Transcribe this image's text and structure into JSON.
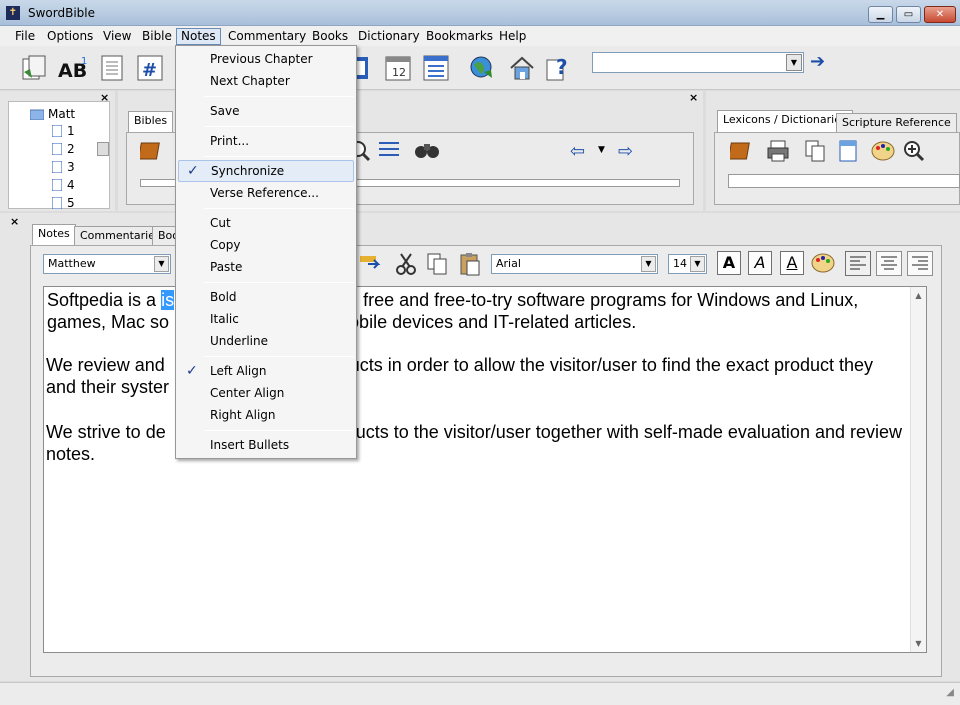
{
  "window": {
    "title": "SwordBible",
    "icon": "bible-icon"
  },
  "menubar": [
    "File",
    "Options",
    "View",
    "Bible",
    "Notes",
    "Commentary",
    "Books",
    "Dictionary",
    "Bookmarks",
    "Help"
  ],
  "toolbar": {
    "icons": [
      "copy-verse-icon",
      "strongs-ab-icon",
      "document-icon",
      "verse-number-icon",
      "calendar-icon",
      "list-icon",
      "globe-icon",
      "home-icon",
      "help-icon"
    ],
    "calendar_number": "12",
    "search_value": ""
  },
  "tree": {
    "root": "Matt",
    "chapters": [
      "1",
      "2",
      "3",
      "4",
      "5"
    ]
  },
  "bible_panel": {
    "tabs": [
      "Bibles"
    ]
  },
  "lexicon_panel": {
    "tabs": [
      "Lexicons / Dictionaries",
      "Scripture Reference"
    ]
  },
  "notes_panel": {
    "tabs": [
      "Notes",
      "Commentaries",
      "Boo"
    ],
    "book_select": "Matthew",
    "font_select": "Arial",
    "size_select": "14",
    "format_buttons": [
      "A",
      "A",
      "A"
    ]
  },
  "editor": {
    "highlight": "is",
    "paragraphs": [
      [
        "Softpedia is a ",
        "is",
        " free and free-to-try software programs for Windows and Linux, games, Mac so",
        "ers, mobile devices and IT-related articles."
      ],
      [
        "We review and ",
        "",
        "ducts in order to allow the visitor/user to find the exact product they and their syster",
        ""
      ],
      [
        "We strive to de",
        "",
        "ducts to the visitor/user together with self-made evaluation and review notes.",
        ""
      ]
    ]
  },
  "notes_menu": {
    "items": [
      {
        "label": "Previous Chapter",
        "checked": false
      },
      {
        "label": "Next Chapter",
        "checked": false
      },
      {
        "sep": true
      },
      {
        "label": "Save",
        "checked": false
      },
      {
        "sep": true
      },
      {
        "label": "Print...",
        "checked": false
      },
      {
        "sep": true
      },
      {
        "label": "Synchronize",
        "checked": true,
        "hover": true
      },
      {
        "label": "Verse Reference...",
        "checked": false
      },
      {
        "sep": true
      },
      {
        "label": "Cut",
        "checked": false
      },
      {
        "label": "Copy",
        "checked": false
      },
      {
        "label": "Paste",
        "checked": false
      },
      {
        "sep": true
      },
      {
        "label": "Bold",
        "checked": false
      },
      {
        "label": "Italic",
        "checked": false
      },
      {
        "label": "Underline",
        "checked": false
      },
      {
        "sep": true
      },
      {
        "label": "Left Align",
        "checked": true
      },
      {
        "label": "Center Align",
        "checked": false
      },
      {
        "label": "Right Align",
        "checked": false
      },
      {
        "sep": true
      },
      {
        "label": "Insert Bullets",
        "checked": false
      }
    ]
  },
  "colors": {
    "accent": "#3399ff",
    "menu_hover": "#e3ecf7",
    "check": "#1c3b87"
  }
}
